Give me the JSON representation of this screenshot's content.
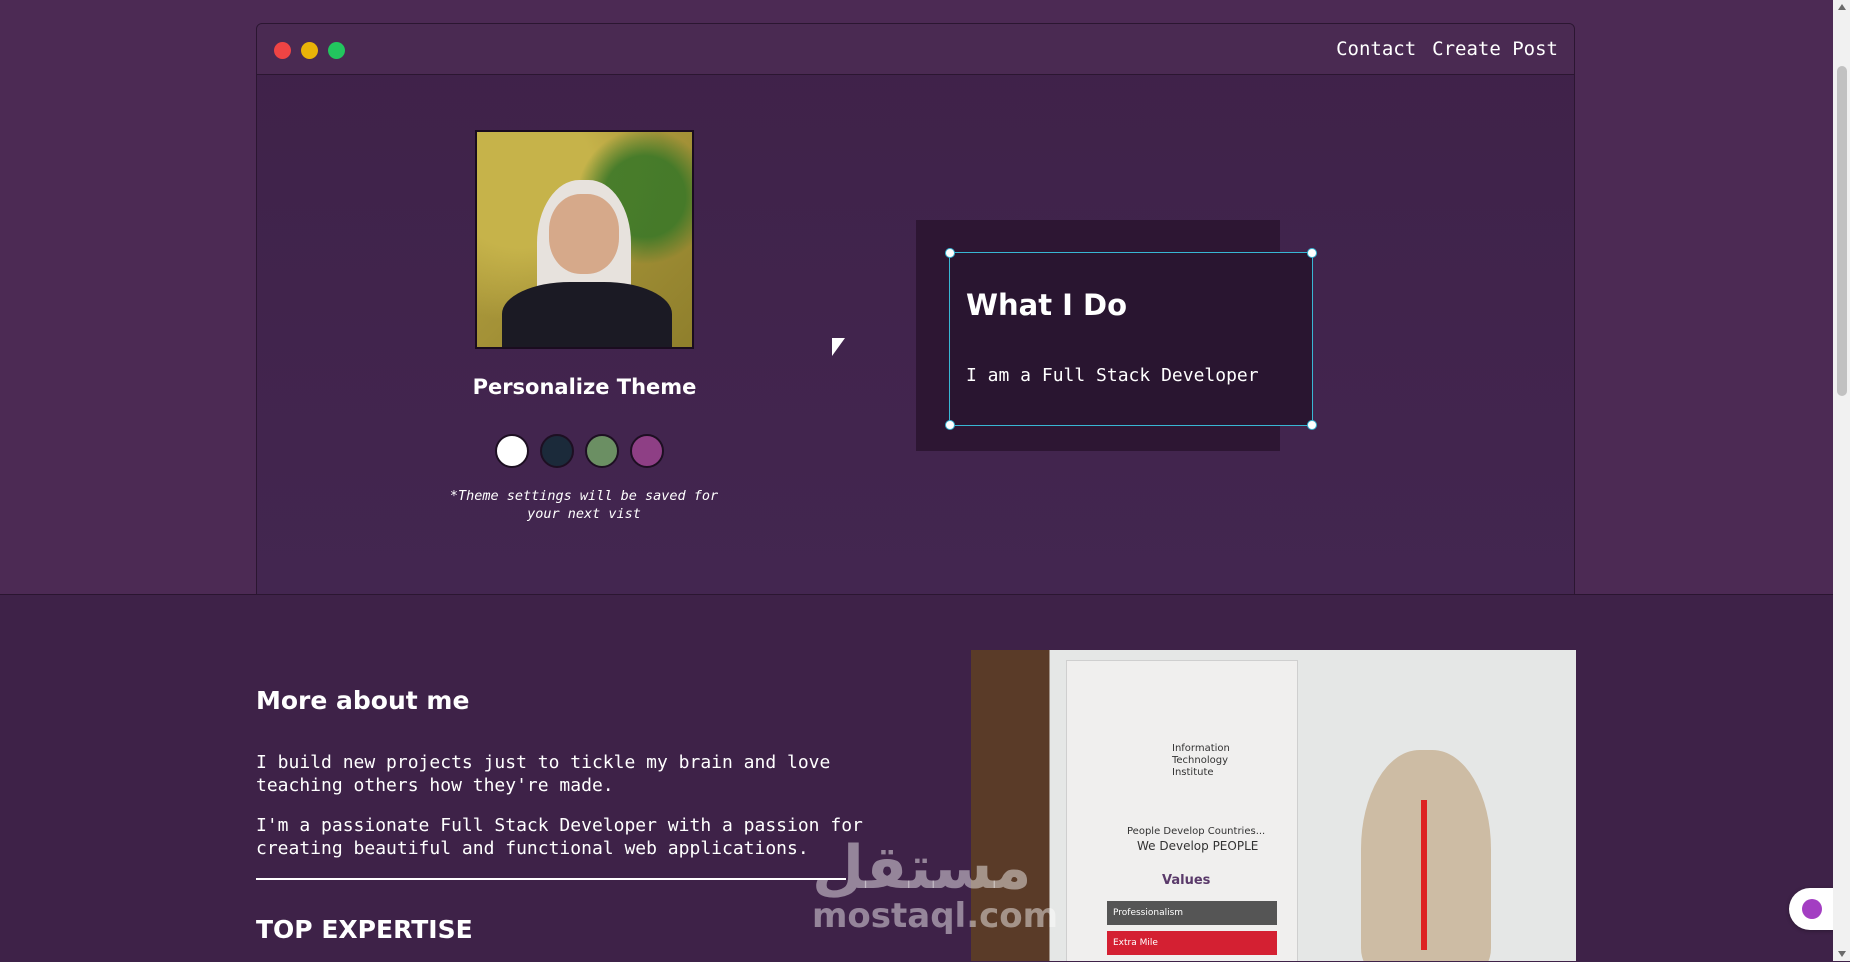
{
  "nav": {
    "items": [
      {
        "label": "Contact"
      },
      {
        "label": "Create Post"
      }
    ]
  },
  "profile": {
    "theme_title": "Personalize Theme",
    "swatches": [
      {
        "color": "#ffffff"
      },
      {
        "color": "#1b2a3a"
      },
      {
        "color": "#6b8f63"
      },
      {
        "color": "#8e3f85"
      }
    ],
    "note_line1": "*Theme settings will be saved for",
    "note_line2": "your next vist"
  },
  "what_i_do": {
    "heading": "What I Do",
    "text": "I am a Full Stack Developer"
  },
  "about": {
    "heading": "More about me",
    "para1": "I build new projects just to tickle my brain and love teaching others how they're made.",
    "para2": "I'm a passionate Full Stack Developer with a passion for creating beautiful and functional web applications.",
    "expertise_heading": "TOP EXPERTISE"
  },
  "photo_banner": {
    "org_line1": "Information",
    "org_line2": "Technology",
    "org_line3": "Institute",
    "slogan1": "People Develop Countries...",
    "slogan2": "We Develop PEOPLE",
    "values": "Values",
    "v1": "Professionalism",
    "v2": "Extra Mile"
  },
  "watermark": {
    "arabic": "مستقل",
    "latin": "mostaql.com"
  },
  "colors": {
    "accent": "#38b6d3",
    "background": "#4c2a54"
  }
}
